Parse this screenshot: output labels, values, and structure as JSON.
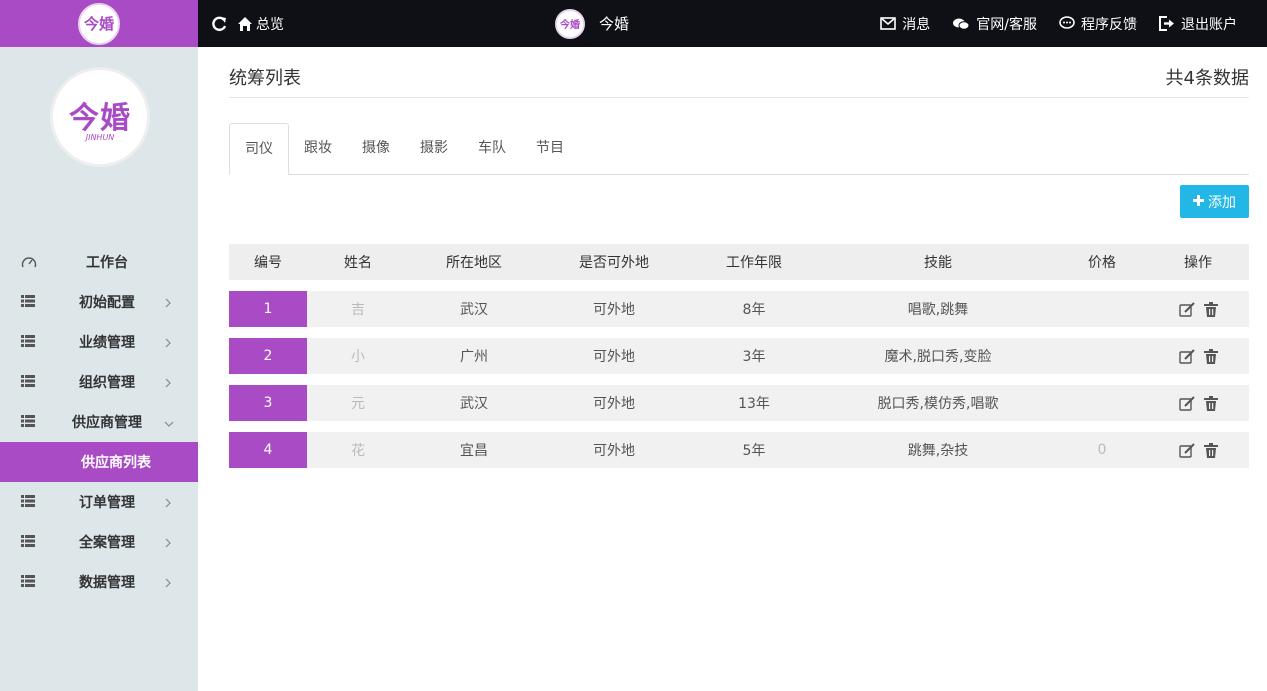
{
  "topbar": {
    "brand_logo": "今婚",
    "home_label": "总览",
    "center_title": "今婚",
    "center_logo": "今婚",
    "messages_label": "消息",
    "service_label": "官网/客服",
    "feedback_label": "程序反馈",
    "logout_label": "退出账户"
  },
  "sidebar": {
    "logo_text": "今婚",
    "logo_sub": "JINHUN",
    "items": [
      {
        "label": "工作台",
        "icon": "dashboard-icon",
        "arrow": false
      },
      {
        "label": "初始配置",
        "icon": "list-icon",
        "arrow": true
      },
      {
        "label": "业绩管理",
        "icon": "list-icon",
        "arrow": true
      },
      {
        "label": "组织管理",
        "icon": "list-icon",
        "arrow": true
      },
      {
        "label": "供应商管理",
        "icon": "list-icon",
        "arrow": "down"
      },
      {
        "label": "供应商列表",
        "icon": "",
        "arrow": false,
        "active": true
      },
      {
        "label": "订单管理",
        "icon": "list-icon",
        "arrow": true
      },
      {
        "label": "全案管理",
        "icon": "list-icon",
        "arrow": true
      },
      {
        "label": "数据管理",
        "icon": "list-icon",
        "arrow": true
      }
    ]
  },
  "page": {
    "title": "统筹列表",
    "count": "共4条数据",
    "add_label": "添加"
  },
  "tabs": [
    "司仪",
    "跟妆",
    "摄像",
    "摄影",
    "车队",
    "节目"
  ],
  "table": {
    "headers": [
      "编号",
      "姓名",
      "所在地区",
      "是否可外地",
      "工作年限",
      "技能",
      "价格",
      "操作"
    ],
    "rows": [
      {
        "id": "1",
        "name": "吉",
        "region": "武汉",
        "remote": "可外地",
        "years": "8年",
        "skills": "唱歌,跳舞",
        "price": ""
      },
      {
        "id": "2",
        "name": "小",
        "region": "广州",
        "remote": "可外地",
        "years": "3年",
        "skills": "魔术,脱口秀,变脸",
        "price": ""
      },
      {
        "id": "3",
        "name": "元",
        "region": "武汉",
        "remote": "可外地",
        "years": "13年",
        "skills": "脱口秀,模仿秀,唱歌",
        "price": ""
      },
      {
        "id": "4",
        "name": "花",
        "region": "宜昌",
        "remote": "可外地",
        "years": "5年",
        "skills": "跳舞,杂技",
        "price": "0"
      }
    ]
  },
  "colors": {
    "brand": "#a94bc4",
    "topbar": "#0f1016",
    "sidebar": "#dde6e9",
    "add_button": "#23b7e5"
  }
}
